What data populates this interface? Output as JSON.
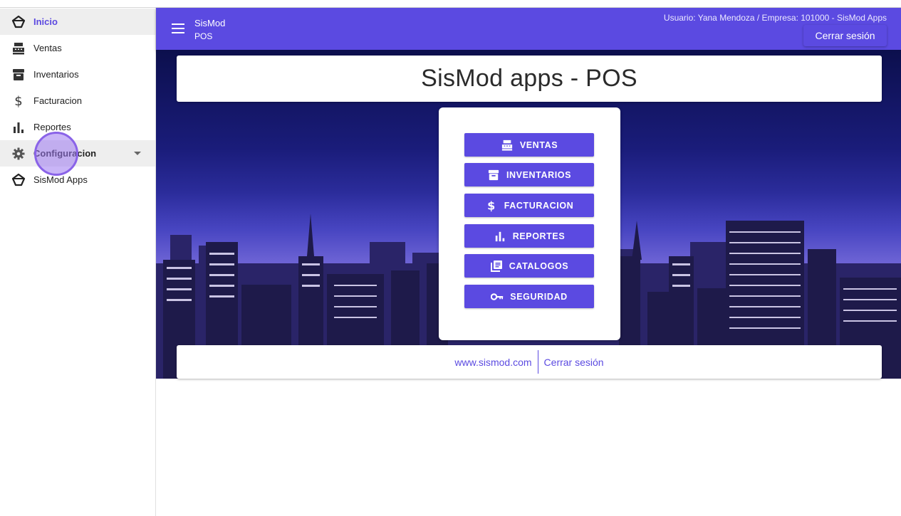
{
  "sidebar": {
    "items": [
      {
        "label": "Inicio",
        "icon": "logo-icon",
        "state": "active"
      },
      {
        "label": "Ventas",
        "icon": "cash-register-icon"
      },
      {
        "label": "Inventarios",
        "icon": "archive-icon"
      },
      {
        "label": "Facturacion",
        "icon": "dollar-icon"
      },
      {
        "label": "Reportes",
        "icon": "bar-chart-icon"
      },
      {
        "label": "Configuracion",
        "icon": "gear-icon",
        "state": "hover",
        "expandable": true
      },
      {
        "label": "SisMod Apps",
        "icon": "logo-icon"
      }
    ]
  },
  "appbar": {
    "brand_line1": "SisMod",
    "brand_line2": "POS",
    "user_info": "Usuario: Yana Mendoza / Empresa: 101000 - SisMod Apps",
    "logout_label": "Cerrar sesión"
  },
  "main": {
    "title": "SisMod apps - POS",
    "buttons": [
      {
        "label": "VENTAS",
        "icon": "cash-register-icon"
      },
      {
        "label": "INVENTARIOS",
        "icon": "archive-icon"
      },
      {
        "label": "FACTURACION",
        "icon": "dollar-icon"
      },
      {
        "label": "REPORTES",
        "icon": "bar-chart-icon"
      },
      {
        "label": "CATALOGOS",
        "icon": "catalog-icon"
      },
      {
        "label": "SEGURIDAD",
        "icon": "key-icon"
      }
    ],
    "footer": {
      "website": "www.sismod.com",
      "logout": "Cerrar sesión"
    }
  },
  "colors": {
    "accent": "#5b4ae1",
    "active_text": "#5c49e0"
  }
}
